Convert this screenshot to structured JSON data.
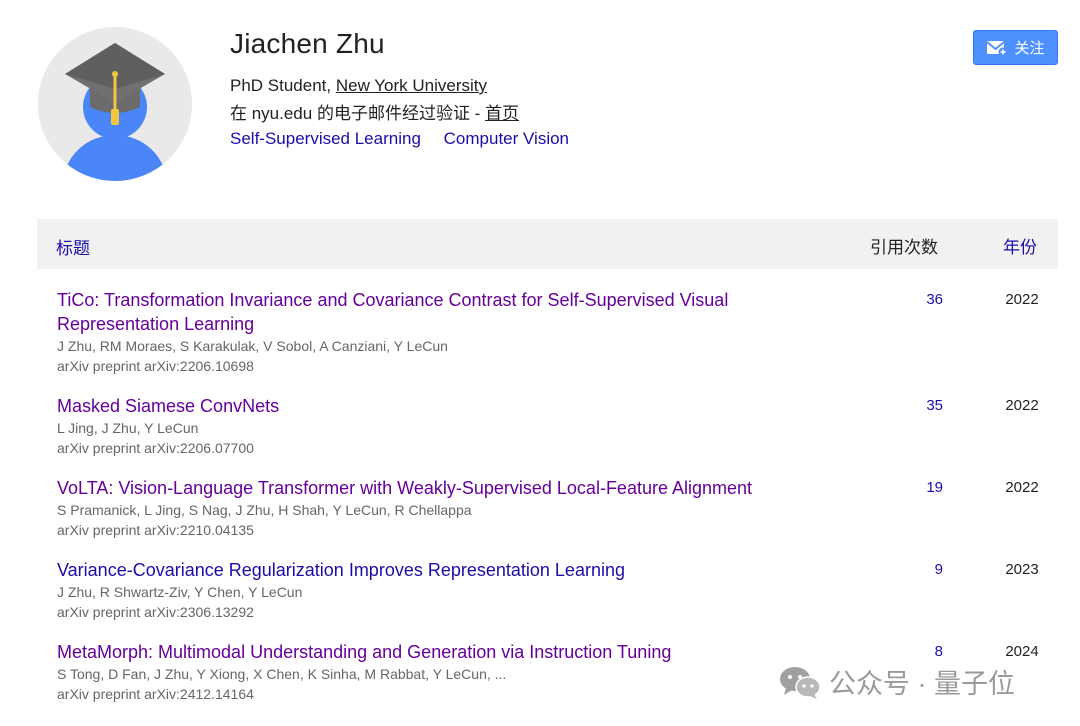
{
  "profile": {
    "name": "Jiachen Zhu",
    "role": "PhD Student, ",
    "affiliation": "New York University",
    "verified_text": "在 nyu.edu 的电子邮件经过验证 - ",
    "homepage": "首页",
    "interests": [
      "Self-Supervised Learning",
      "Computer Vision"
    ]
  },
  "follow_button": {
    "label": "关注"
  },
  "table": {
    "headers": {
      "title": "标题",
      "cites": "引用次数",
      "year": "年份"
    },
    "rows": [
      {
        "title": "TiCo: Transformation Invariance and Covariance Contrast for Self-Supervised Visual Representation Learning",
        "authors": "J Zhu, RM Moraes, S Karakulak, V Sobol, A Canziani, Y LeCun",
        "venue": "arXiv preprint arXiv:2206.10698",
        "cites": "36",
        "year": "2022"
      },
      {
        "title": "Masked Siamese ConvNets",
        "authors": "L Jing, J Zhu, Y LeCun",
        "venue": "arXiv preprint arXiv:2206.07700",
        "cites": "35",
        "year": "2022"
      },
      {
        "title": "VoLTA: Vision-Language Transformer with Weakly-Supervised Local-Feature Alignment",
        "authors": "S Pramanick, L Jing, S Nag, J Zhu, H Shah, Y LeCun, R Chellappa",
        "venue": "arXiv preprint arXiv:2210.04135",
        "cites": "19",
        "year": "2022"
      },
      {
        "title": "Variance-Covariance Regularization Improves Representation Learning",
        "authors": "J Zhu, R Shwartz-Ziv, Y Chen, Y LeCun",
        "venue": "arXiv preprint arXiv:2306.13292",
        "cites": "9",
        "year": "2023"
      },
      {
        "title": "MetaMorph: Multimodal Understanding and Generation via Instruction Tuning",
        "authors": "S Tong, D Fan, J Zhu, Y Xiong, X Chen, K Sinha, M Rabbat, Y LeCun, ...",
        "venue": "arXiv preprint arXiv:2412.14164",
        "cites": "8",
        "year": "2024"
      }
    ]
  },
  "watermark": {
    "text": "公众号 · 量子位"
  },
  "colors": {
    "link": "#1a0dab",
    "visited": "#660099",
    "button": "#4d90fe",
    "header_bg": "#f1f1f1"
  }
}
